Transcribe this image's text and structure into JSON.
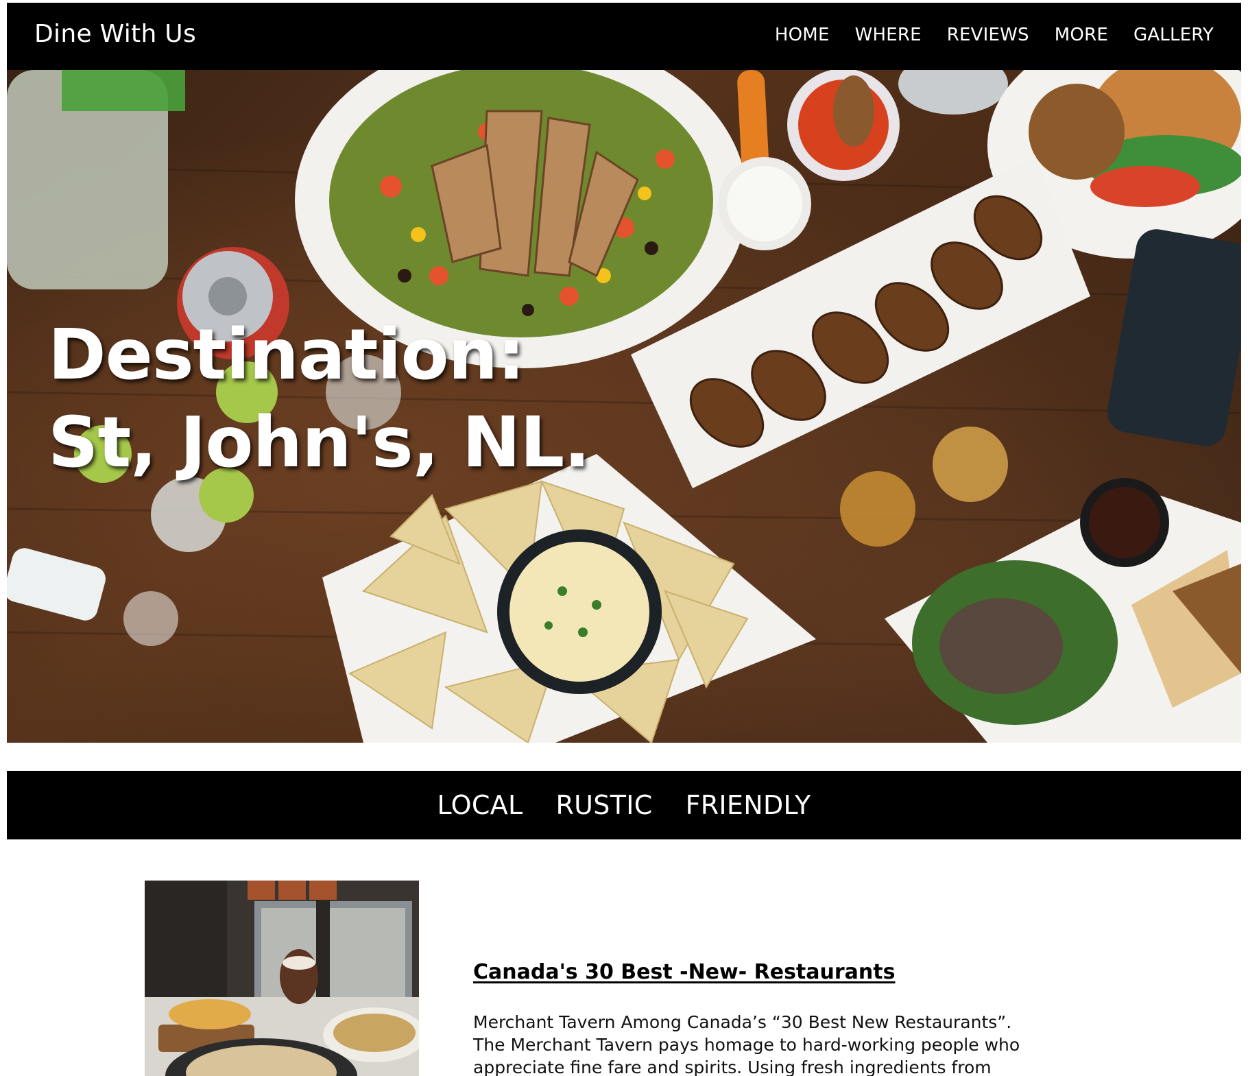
{
  "nav": {
    "brand": "Dine With Us",
    "links": [
      "HOME",
      "WHERE",
      "REVIEWS",
      "MORE",
      "GALLERY"
    ]
  },
  "hero": {
    "title_line1": "Destination:",
    "title_line2": "St, John's, NL."
  },
  "tagline": {
    "words": [
      "LOCAL",
      "RUSTIC",
      "FRIENDLY"
    ]
  },
  "article": {
    "title": "Canada's 30 Best -New- Restaurants",
    "body": "Merchant Tavern Among Canada’s “30 Best New Restaurants”. The Merchant Tavern pays homage to hard-working people who appreciate fine fare and spirits. Using fresh ingredients from local"
  },
  "colors": {
    "navbar": "#000000",
    "text_light": "#ffffff",
    "page_bg": "#ffffff"
  }
}
